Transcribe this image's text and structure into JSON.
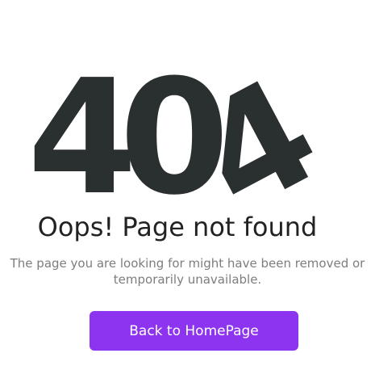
{
  "error": {
    "code_first": "4",
    "code_middle": "0",
    "code_last": "4",
    "title": "Oops! Page not found",
    "message_line1": "The page you are looking for might have been removed or",
    "message_line2": "temporarily unavailable."
  },
  "actions": {
    "home_label": "Back to HomePage"
  },
  "colors": {
    "digits": "#2a2f2f",
    "button": "#8d34f0",
    "title": "#222222",
    "message": "#7d7d7d"
  }
}
